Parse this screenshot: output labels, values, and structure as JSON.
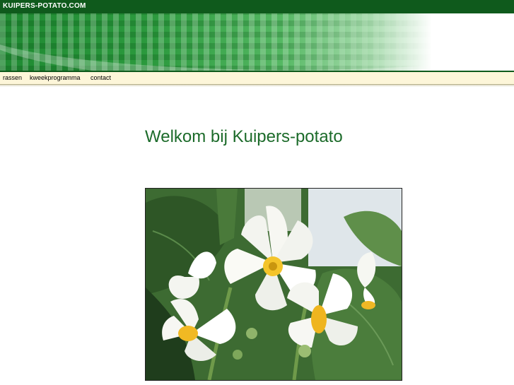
{
  "header": {
    "site_title": "KUIPERS-POTATO.COM"
  },
  "nav": {
    "items": [
      {
        "label": "rassen"
      },
      {
        "label": "kweekprogramma"
      },
      {
        "label": "contact"
      }
    ]
  },
  "main": {
    "welcome_heading": "Welkom bij Kuipers-potato"
  },
  "colors": {
    "topbar": "#0f5a1c",
    "banner_green": "#2c9a3e",
    "nav_background": "#fdf6d9",
    "heading": "#1c6b2a"
  },
  "icons": {
    "photo": "potato-flower-image"
  }
}
